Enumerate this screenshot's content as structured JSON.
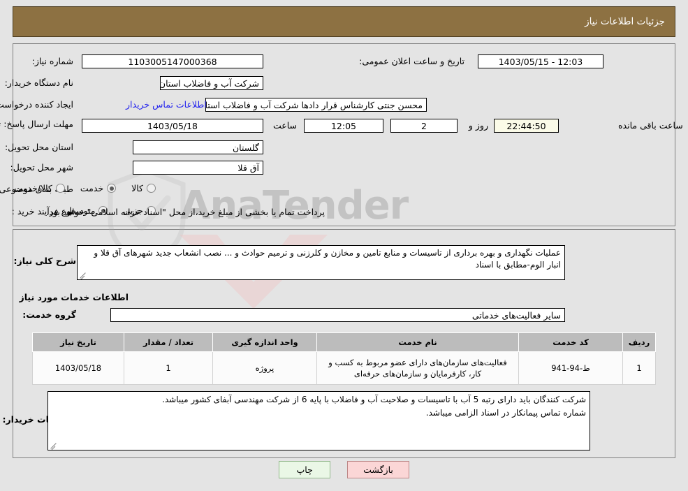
{
  "header": {
    "title": "جزئیات اطلاعات نیاز"
  },
  "form": {
    "need_number_label": "شماره نیاز:",
    "need_number_value": "1103005147000368",
    "announce_datetime_label": "تاریخ و ساعت اعلان عمومی:",
    "announce_datetime_value": "1403/05/15 - 12:03",
    "buyer_org_label": "نام دستگاه خریدار:",
    "buyer_org_value": "شرکت آب و فاضلاب استان گلستان",
    "requester_label": "ایجاد کننده درخواست:",
    "requester_value": "محسن جنتی کارشناس قرار دادها شرکت آب و فاضلاب استان گلستان",
    "buyer_contact_link": "اطلاعات تماس خریدار",
    "deadline_label": "مهلت ارسال پاسخ: تا تاریخ:",
    "deadline_date_value": "1403/05/18",
    "time_label": "ساعت",
    "deadline_time_value": "12:05",
    "days_value": "2",
    "days_suffix": "روز و",
    "countdown_value": "22:44:50",
    "countdown_suffix": "ساعت باقی مانده",
    "province_label": "استان محل تحویل:",
    "province_value": "گلستان",
    "city_label": "شهر محل تحویل:",
    "city_value": "آق قلا",
    "category_label": "طبقه بندی موضوعی:",
    "category_options": [
      {
        "label": "کالا",
        "selected": false
      },
      {
        "label": "خدمت",
        "selected": true
      },
      {
        "label": "کالا/خدمت",
        "selected": false
      }
    ],
    "purchase_type_label": "نوع فرآیند خرید :",
    "purchase_type_options": [
      {
        "label": "جزیی",
        "selected": false
      },
      {
        "label": "متوسط",
        "selected": true
      }
    ],
    "payment_note": "پرداخت تمام یا بخشی از مبلغ خرید،از محل \"اسناد خزانه اسلامی\" خواهد بود."
  },
  "description": {
    "label": "شرح کلی نیاز:",
    "value": "عملیات نگهداری و بهره برداری از تاسیسات و منابع تامین و مخازن و کلرزنی و ترمیم حوادث و ... نصب انشعاب جدید شهرهای آق قلا و انبار الوم-مطابق با اسناد"
  },
  "services_section": {
    "title": "اطلاعات خدمات مورد نیاز",
    "group_label": "گروه خدمت:",
    "group_value": "سایر فعالیت‌های خدماتی"
  },
  "table": {
    "headers": [
      "ردیف",
      "کد خدمت",
      "نام خدمت",
      "واحد اندازه گیری",
      "تعداد / مقدار",
      "تاریخ نیاز"
    ],
    "rows": [
      {
        "row": "1",
        "code": "ط-94-941",
        "name": "فعالیت‌های سازمان‌های دارای عضو مربوط به کسب و کار، کارفرمایان و سازمان‌های حرفه‌ای",
        "unit": "پروژه",
        "quantity": "1",
        "need_date": "1403/05/18"
      }
    ]
  },
  "buyer_notes": {
    "label": "توضیحات خریدار:",
    "line1": "شرکت کنندگان باید دارای رتبه 5 آب با تاسیسات و صلاحیت آب و فاضلاب با پایه 6 از شرکت مهندسی آبفای کشور میباشد.",
    "line2": "شماره تماس پیمانکار در اسناد الزامی میباشد."
  },
  "buttons": {
    "print": "چاپ",
    "back": "بازگشت"
  },
  "watermark": {
    "text": "AnaTender",
    "text2": "////"
  },
  "colors": {
    "header_brown": "#8d7142",
    "link_blue": "#2222ee",
    "table_header_gray": "#bcbcbc",
    "countdown_cream": "#fbfbe8",
    "back_button_pink": "#fbd6d6",
    "print_button_green": "#eaf7e6"
  }
}
